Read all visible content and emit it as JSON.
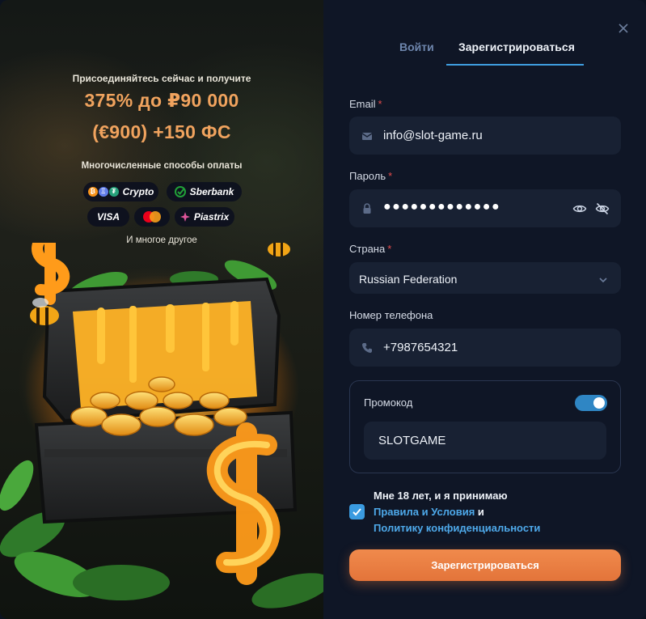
{
  "promo": {
    "join_text": "Присоединяйтесь сейчас и получите",
    "bonus_line1": "375% до ₽90 000",
    "bonus_line2": "(€900) +150 ФС",
    "payments_title": "Многочисленные способы оплаты",
    "payment_methods": [
      "Crypto",
      "Sberbank",
      "VISA",
      "Piastrix"
    ],
    "more_text": "И многое другое"
  },
  "tabs": {
    "login_label": "Войти",
    "register_label": "Зарегистрироваться",
    "active": "register"
  },
  "close_icon": "close-icon",
  "form": {
    "email_label": "Email",
    "email_value": "info@slot-game.ru",
    "password_label": "Пароль",
    "password_value": "●●●●●●●●●●●●●",
    "country_label": "Страна",
    "country_value": "Russian Federation",
    "phone_label": "Номер телефона",
    "phone_value": "+7987654321",
    "required_mark": "*",
    "promo_label": "Промокод",
    "promo_enabled": true,
    "promo_value": "SLOTGAME",
    "terms_checked": true,
    "terms_prefix": "Мне 18 лет, и я принимаю",
    "terms_link": "Правила и Условия",
    "terms_and": "и",
    "privacy_link": "Политику конфиденциальности",
    "submit_label": "Зарегистрироваться"
  },
  "colors": {
    "accent_orange": "#f0a35e",
    "link_blue": "#4ea9ea",
    "tab_underline": "#3f9ee0",
    "button_orange": "#e3743a",
    "required_red": "#e34b4b"
  }
}
